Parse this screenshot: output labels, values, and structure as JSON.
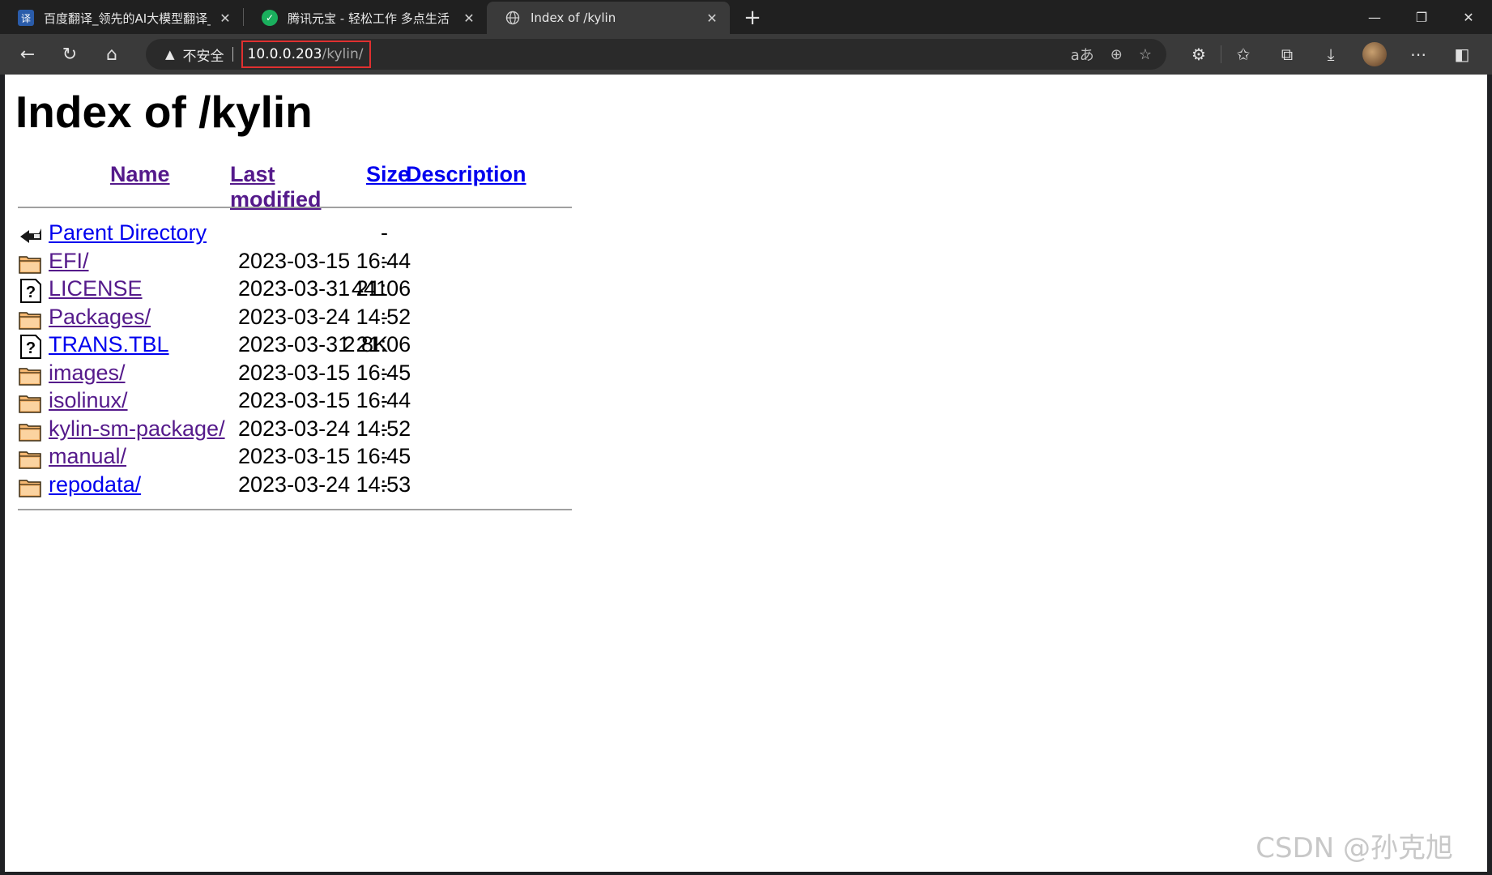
{
  "tabs": [
    {
      "title": "百度翻译_领先的AI大模型翻译_支",
      "favicon": "译",
      "favicon_bg": "#2a5caa",
      "active": false
    },
    {
      "title": "腾讯元宝 - 轻松工作 多点生活",
      "favicon": "✓",
      "favicon_bg": "#1aaf5d",
      "active": false
    },
    {
      "title": "Index of /kylin",
      "favicon": "globe-icon",
      "favicon_bg": "",
      "active": true
    }
  ],
  "address_bar": {
    "security_label": "不安全",
    "url_host": "10.0.0.203",
    "url_path": "/kylin/"
  },
  "page": {
    "heading": "Index of /kylin",
    "columns": {
      "name": "Name",
      "last_modified": "Last modified",
      "size": "Size",
      "description": "Description"
    },
    "entries": [
      {
        "name": "Parent Directory",
        "modified": "",
        "size": "-",
        "icon": "back-icon",
        "visited": false
      },
      {
        "name": "EFI/",
        "modified": "2023-03-15 16:44",
        "size": "-",
        "icon": "folder-icon",
        "visited": true
      },
      {
        "name": "LICENSE",
        "modified": "2023-03-31 21:06",
        "size": "441",
        "icon": "unknown-file-icon",
        "visited": true
      },
      {
        "name": "Packages/",
        "modified": "2023-03-24 14:52",
        "size": "-",
        "icon": "folder-icon",
        "visited": true
      },
      {
        "name": "TRANS.TBL",
        "modified": "2023-03-31 21:06",
        "size": "2.8K",
        "icon": "unknown-file-icon",
        "visited": false
      },
      {
        "name": "images/",
        "modified": "2023-03-15 16:45",
        "size": "-",
        "icon": "folder-icon",
        "visited": true
      },
      {
        "name": "isolinux/",
        "modified": "2023-03-15 16:44",
        "size": "-",
        "icon": "folder-icon",
        "visited": true
      },
      {
        "name": "kylin-sm-package/",
        "modified": "2023-03-24 14:52",
        "size": "-",
        "icon": "folder-icon",
        "visited": true
      },
      {
        "name": "manual/",
        "modified": "2023-03-15 16:45",
        "size": "-",
        "icon": "folder-icon",
        "visited": true
      },
      {
        "name": "repodata/",
        "modified": "2023-03-24 14:53",
        "size": "-",
        "icon": "folder-icon",
        "visited": false
      }
    ]
  },
  "watermark": "CSDN @孙克旭",
  "colors": {
    "visited_link": "#551a8b",
    "link": "#0000ee",
    "highlight_box": "#e03030"
  }
}
